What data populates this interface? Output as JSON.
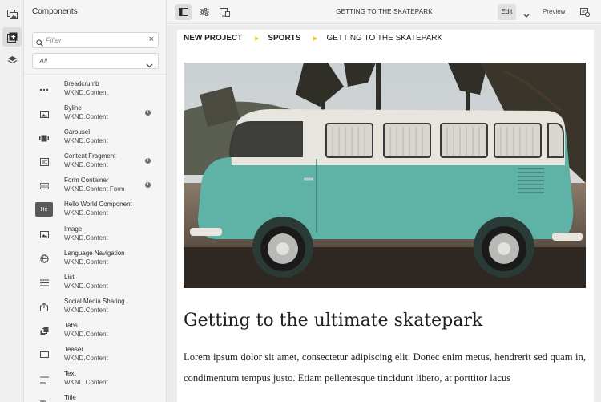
{
  "panel": {
    "title": "Components",
    "filter_placeholder": "Filter",
    "group_select": "All"
  },
  "components": [
    {
      "name": "Breadcrumb",
      "group": "WKND.Content",
      "icon": "breadcrumb-dots-icon",
      "info": false
    },
    {
      "name": "Byline",
      "group": "WKND.Content",
      "icon": "image-icon",
      "info": true
    },
    {
      "name": "Carousel",
      "group": "WKND.Content",
      "icon": "carousel-icon",
      "info": false
    },
    {
      "name": "Content Fragment",
      "group": "WKND.Content",
      "icon": "content-fragment-icon",
      "info": true
    },
    {
      "name": "Form Container",
      "group": "WKND.Content Form",
      "icon": "form-icon",
      "info": true
    },
    {
      "name": "Hello World Component",
      "group": "WKND.Content",
      "icon": "He",
      "info": false
    },
    {
      "name": "Image",
      "group": "WKND.Content",
      "icon": "image-icon",
      "info": false
    },
    {
      "name": "Language Navigation",
      "group": "WKND.Content",
      "icon": "globe-icon",
      "info": false
    },
    {
      "name": "List",
      "group": "WKND.Content",
      "icon": "list-icon",
      "info": false
    },
    {
      "name": "Social Media Sharing",
      "group": "WKND.Content",
      "icon": "share-icon",
      "info": false
    },
    {
      "name": "Tabs",
      "group": "WKND.Content",
      "icon": "tabs-icon",
      "info": false
    },
    {
      "name": "Teaser",
      "group": "WKND.Content",
      "icon": "teaser-icon",
      "info": false
    },
    {
      "name": "Text",
      "group": "WKND.Content",
      "icon": "text-icon",
      "info": false
    },
    {
      "name": "Title",
      "group": "",
      "icon": "title-icon",
      "info": false
    }
  ],
  "toolbar": {
    "page_title": "GETTING TO THE SKATEPARK",
    "mode": "Edit",
    "preview": "Preview"
  },
  "page": {
    "breadcrumb": [
      "NEW PROJECT",
      "SPORTS",
      "GETTING TO THE SKATEPARK"
    ],
    "heading": "Getting to the ultimate skatepark",
    "body": "Lorem ipsum dolor sit amet, consectetur adipiscing elit. Donec enim metus, hendrerit sed quam in, condimentum tempus justo. Etiam pellentesque tincidunt libero, at porttitor lacus"
  },
  "colors": {
    "breadcrumb_arrow": "#f0c419",
    "van_body": "#5fb2a6"
  }
}
